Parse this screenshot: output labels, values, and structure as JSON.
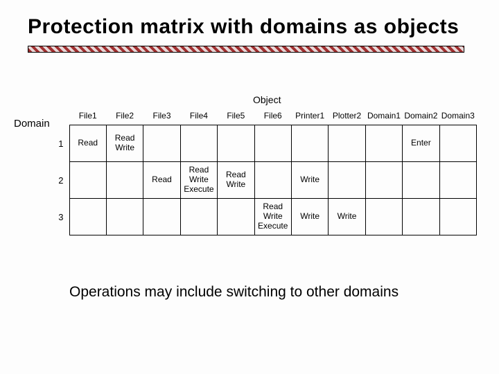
{
  "title": "Protection matrix with domains as objects",
  "labels": {
    "domain": "Domain",
    "object": "Object"
  },
  "columns": [
    "File1",
    "File2",
    "File3",
    "File4",
    "File5",
    "File6",
    "Printer1",
    "Plotter2",
    "Domain1",
    "Domain2",
    "Domain3"
  ],
  "rows": [
    "1",
    "2",
    "3"
  ],
  "cells": {
    "r1": {
      "File1": "Read",
      "File2": "Read\nWrite",
      "File3": "",
      "File4": "",
      "File5": "",
      "File6": "",
      "Printer1": "",
      "Plotter2": "",
      "Domain1": "",
      "Domain2": "Enter",
      "Domain3": ""
    },
    "r2": {
      "File1": "",
      "File2": "",
      "File3": "Read",
      "File4": "Read\nWrite\nExecute",
      "File5": "Read\nWrite",
      "File6": "",
      "Printer1": "Write",
      "Plotter2": "",
      "Domain1": "",
      "Domain2": "",
      "Domain3": ""
    },
    "r3": {
      "File1": "",
      "File2": "",
      "File3": "",
      "File4": "",
      "File5": "",
      "File6": "Read\nWrite\nExecute",
      "Printer1": "Write",
      "Plotter2": "Write",
      "Domain1": "",
      "Domain2": "",
      "Domain3": ""
    }
  },
  "caption": "Operations may include switching to other domains",
  "chart_data": {
    "type": "table",
    "title": "Protection matrix with domains as objects",
    "row_label": "Domain",
    "col_label": "Object",
    "columns": [
      "File1",
      "File2",
      "File3",
      "File4",
      "File5",
      "File6",
      "Printer1",
      "Plotter2",
      "Domain1",
      "Domain2",
      "Domain3"
    ],
    "rows": [
      {
        "domain": "1",
        "rights": {
          "File1": [
            "Read"
          ],
          "File2": [
            "Read",
            "Write"
          ],
          "Domain2": [
            "Enter"
          ]
        }
      },
      {
        "domain": "2",
        "rights": {
          "File3": [
            "Read"
          ],
          "File4": [
            "Read",
            "Write",
            "Execute"
          ],
          "File5": [
            "Read",
            "Write"
          ],
          "Printer1": [
            "Write"
          ]
        }
      },
      {
        "domain": "3",
        "rights": {
          "File6": [
            "Read",
            "Write",
            "Execute"
          ],
          "Printer1": [
            "Write"
          ],
          "Plotter2": [
            "Write"
          ]
        }
      }
    ]
  }
}
